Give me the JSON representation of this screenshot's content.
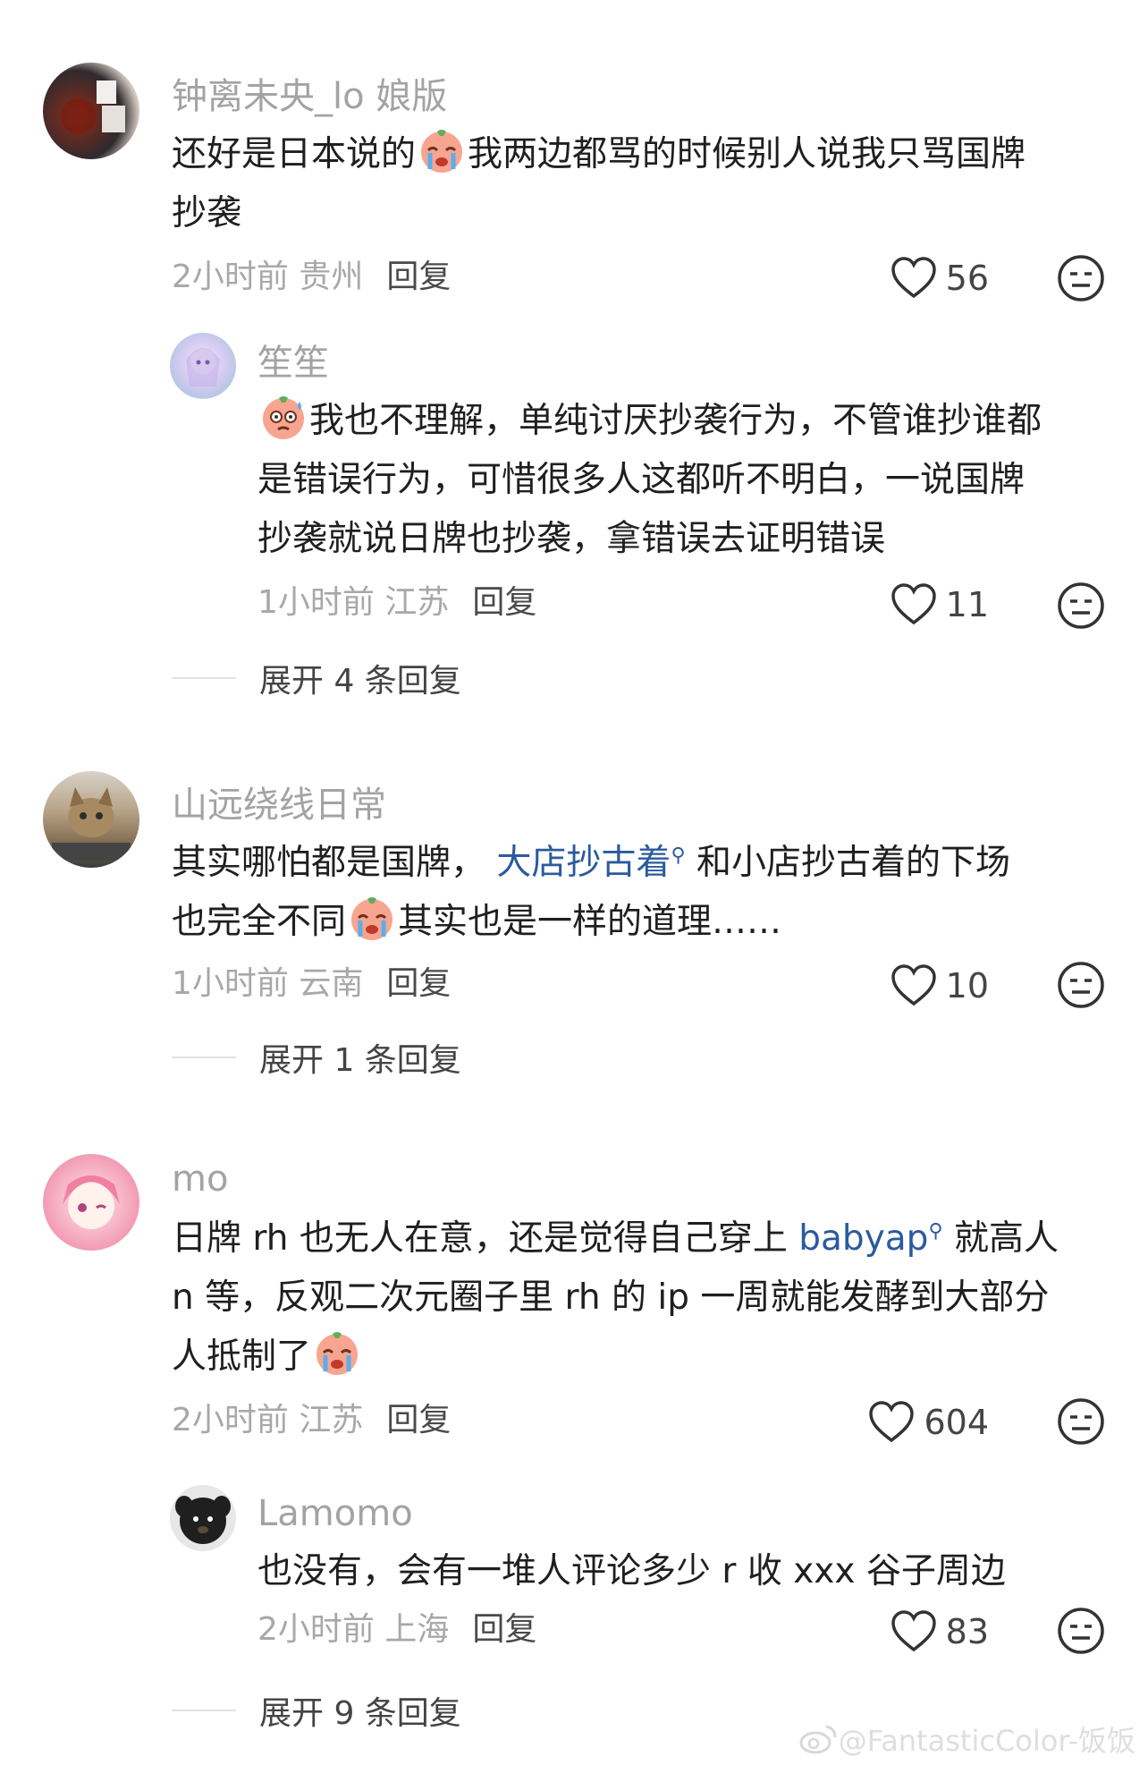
{
  "comments": [
    {
      "username": "钟离未央_lo 娘版",
      "lines": [
        "还好是日本说的",
        "我两边都骂的时候别人说我只骂国牌",
        "抄袭"
      ],
      "time": "2小时前",
      "location": "贵州",
      "reply_label": "回复",
      "likes": "56",
      "sub": {
        "username": "笙笙",
        "lines": [
          "我也不理解，单纯讨厌抄袭行为，不管谁抄谁都",
          "是错误行为，可惜很多人这都听不明白，一说国牌",
          "抄袭就说日牌也抄袭，拿错误去证明错误"
        ],
        "time": "1小时前",
        "location": "江苏",
        "reply_label": "回复",
        "likes": "11"
      },
      "expand": "展开 4 条回复"
    },
    {
      "username": "山远绕线日常",
      "lines": [
        "其实哪怕都是国牌，",
        "大店抄古着",
        "和小店抄古着的下场",
        "也完全不同",
        "其实也是一样的道理……"
      ],
      "time": "1小时前",
      "location": "云南",
      "reply_label": "回复",
      "likes": "10",
      "expand": "展开 1 条回复"
    },
    {
      "username": "mo",
      "lines": [
        "日牌 rh 也无人在意，还是觉得自己穿上",
        "babyap",
        "就高人",
        "n 等，反观二次元圈子里 rh 的 ip 一周就能发酵到大部分",
        "人抵制了"
      ],
      "time": "2小时前",
      "location": "江苏",
      "reply_label": "回复",
      "likes": "604",
      "sub": {
        "username": "Lamomo",
        "lines": [
          "也没有，会有一堆人评论多少 r 收 xxx 谷子周边"
        ],
        "time": "2小时前",
        "location": "上海",
        "reply_label": "回复",
        "likes": "83"
      },
      "expand": "展开 9 条回复"
    }
  ],
  "watermark": "@FantasticColor-饭饭",
  "colors": {
    "link": "#2b5a9e",
    "meta": "#a8a8a8",
    "username": "#a3a3a3"
  },
  "icons": [
    "heart-icon",
    "neutral-face-icon",
    "search-icon",
    "crying-emoji-icon",
    "sweat-emoji-icon",
    "weibo-logo-icon"
  ]
}
